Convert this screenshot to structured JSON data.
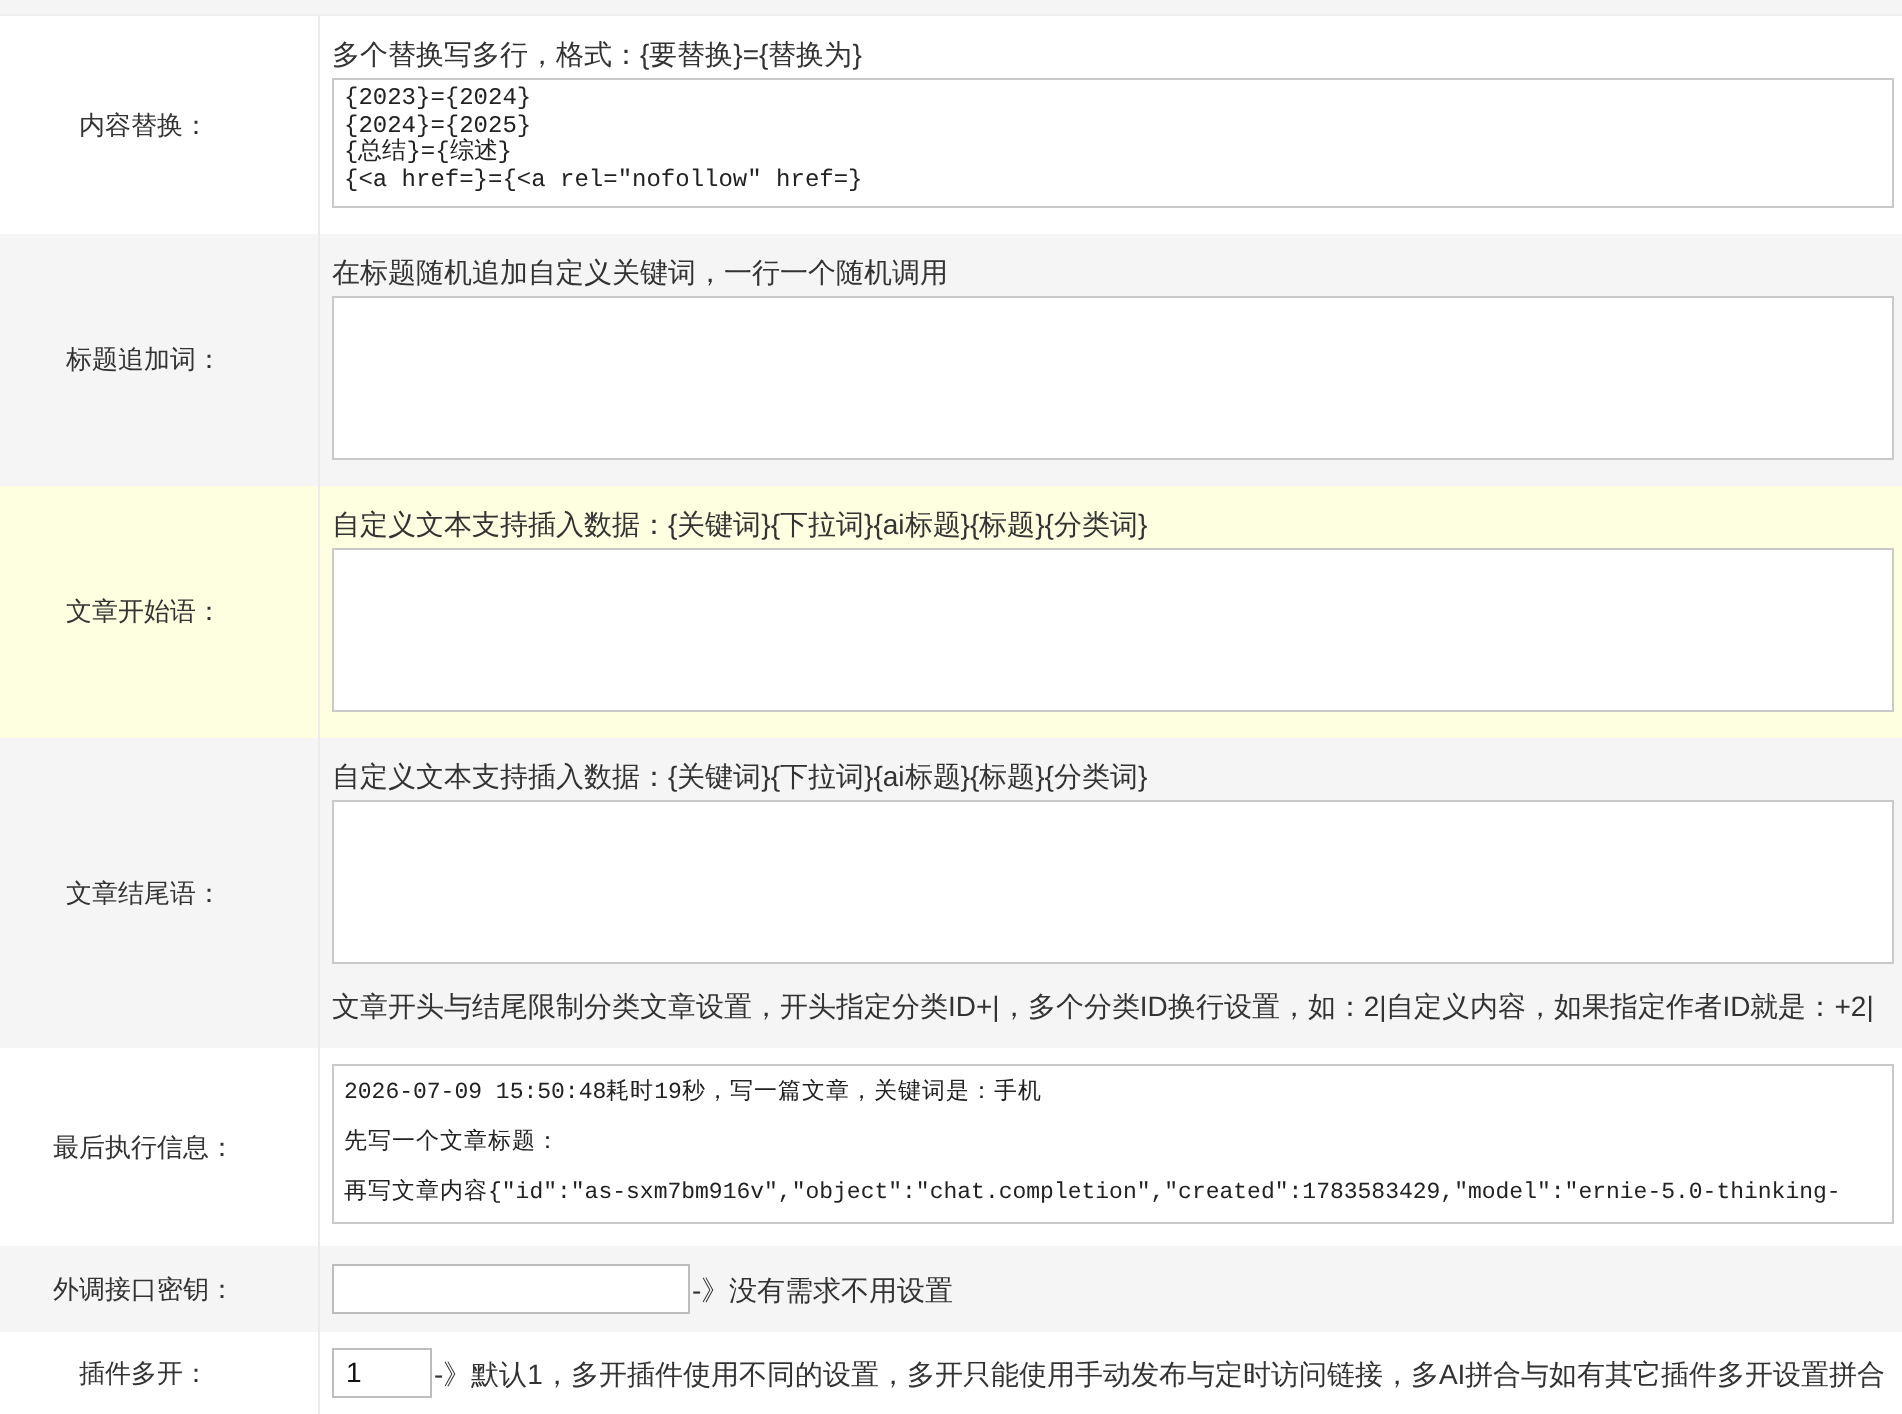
{
  "form": {
    "rows": [
      {
        "label": "内容替换：",
        "highlighted": false,
        "hint": "多个替换写多行，格式：{要替换}={替换为}",
        "field": {
          "kind": "textarea",
          "lines": [
            "{2023}={2024}",
            "{2024}={2025}",
            "{总结}={综述}",
            "{<a href=}={<a rel=\"nofollow\" href=}"
          ]
        }
      },
      {
        "label": "标题追加词：",
        "highlighted": false,
        "hint": "在标题随机追加自定义关键词，一行一个随机调用",
        "field": {
          "kind": "textarea"
        }
      },
      {
        "label": "文章开始语：",
        "highlighted": true,
        "hint": "自定义文本支持插入数据：{关键词}{下拉词}{ai标题}{标题}{分类词}",
        "field": {
          "kind": "textarea"
        }
      },
      {
        "label": "文章结尾语：",
        "highlighted": false,
        "hint": "自定义文本支持插入数据：{关键词}{下拉词}{ai标题}{标题}{分类词}",
        "field": {
          "kind": "textarea"
        },
        "note": "文章开头与结尾限制分类文章设置，开头指定分类ID+|，多个分类ID换行设置，如：2|自定义内容，如果指定作者ID就是：+2|"
      },
      {
        "label": "最后执行信息：",
        "highlighted": false,
        "field": {
          "kind": "log",
          "lines": [
            "2026-07-09 15:50:48耗时19秒，写一篇文章，关键词是：手机",
            "先写一个文章标题：",
            "再写文章内容{\"id\":\"as-sxm7bm916v\",\"object\":\"chat.completion\",\"created\":1783583429,\"model\":\"ernie-5.0-thinking-"
          ]
        }
      },
      {
        "label": "外调接口密钥：",
        "highlighted": false,
        "field": {
          "kind": "text-input"
        },
        "suffix": "-》没有需求不用设置"
      },
      {
        "label": "插件多开：",
        "highlighted": false,
        "field": {
          "kind": "number-input",
          "value": "1"
        },
        "suffix": "-》默认1，多开插件使用不同的设置，多开只能使用手动发布与定时访问链接，多AI拼合与如有其它插件多开设置拼合"
      }
    ]
  }
}
